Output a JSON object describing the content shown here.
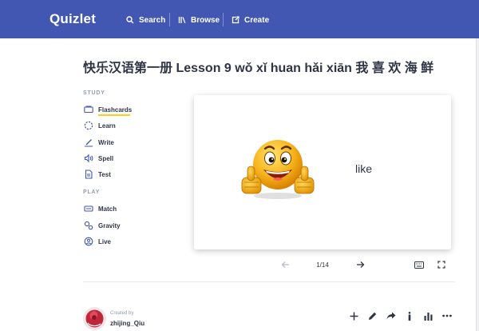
{
  "header": {
    "logo": "Quizlet",
    "nav": [
      {
        "label": "Search",
        "icon": "search-icon"
      },
      {
        "label": "Browse",
        "icon": "library-icon"
      },
      {
        "label": "Create",
        "icon": "create-icon"
      }
    ]
  },
  "title": "快乐汉语第一册 Lesson 9 wǒ xǐ huan hǎi xiān 我 喜 欢 海 鲜",
  "sidebar": {
    "study_label": "STUDY",
    "study_items": [
      {
        "label": "Flashcards",
        "icon": "flashcards-icon",
        "active": true
      },
      {
        "label": "Learn",
        "icon": "learn-icon"
      },
      {
        "label": "Write",
        "icon": "write-icon"
      },
      {
        "label": "Spell",
        "icon": "spell-icon"
      },
      {
        "label": "Test",
        "icon": "test-icon"
      }
    ],
    "play_label": "PLAY",
    "play_items": [
      {
        "label": "Match",
        "icon": "match-icon"
      },
      {
        "label": "Gravity",
        "icon": "gravity-icon"
      },
      {
        "label": "Live",
        "icon": "live-icon"
      }
    ]
  },
  "card": {
    "word": "like",
    "image": "smiley-thumbs-up-emoji"
  },
  "controls": {
    "counter": "1/14"
  },
  "footer": {
    "created_by_label": "Created by",
    "username": "zhijing_Qiu"
  },
  "colors": {
    "header_bg": "#4257b2",
    "active_underline": "#ffcd1f",
    "text": "#303545",
    "muted": "#939bb4"
  }
}
